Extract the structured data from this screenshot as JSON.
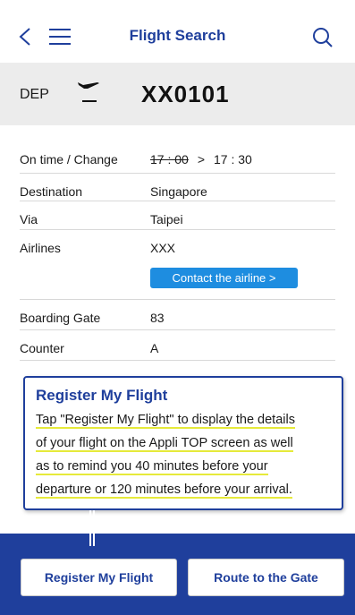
{
  "header": {
    "title": "Flight Search",
    "icons": [
      "chevron-left-icon",
      "menu-icon",
      "search-icon"
    ]
  },
  "flight": {
    "direction": "DEP",
    "number": "XX0101"
  },
  "details": [
    {
      "label": "On time / Change",
      "old_time": "17 : 00",
      "arrow": ">",
      "new_time": "17 : 30"
    },
    {
      "label": "Destination",
      "value": "Singapore"
    },
    {
      "label": "Via",
      "value": "Taipei"
    },
    {
      "label": "Airlines",
      "value": "XXX",
      "button": "Contact the airline >"
    },
    {
      "label": "Boarding Gate",
      "value": "83"
    },
    {
      "label": "Counter",
      "value": "A"
    }
  ],
  "callout": {
    "title": "Register My Flight",
    "lines": [
      "Tap \"Register My Flight\" to display the details",
      "of your flight on the Appli TOP screen as well",
      "as to remind you 40 minutes before your",
      "departure or 120 minutes before your arrival."
    ]
  },
  "bottom": {
    "register": "Register My Flight",
    "route": "Route to the Gate"
  },
  "colors": {
    "brand": "#1f3f9c",
    "accent": "#1e8de0",
    "highlight": "#e6ea3a"
  }
}
